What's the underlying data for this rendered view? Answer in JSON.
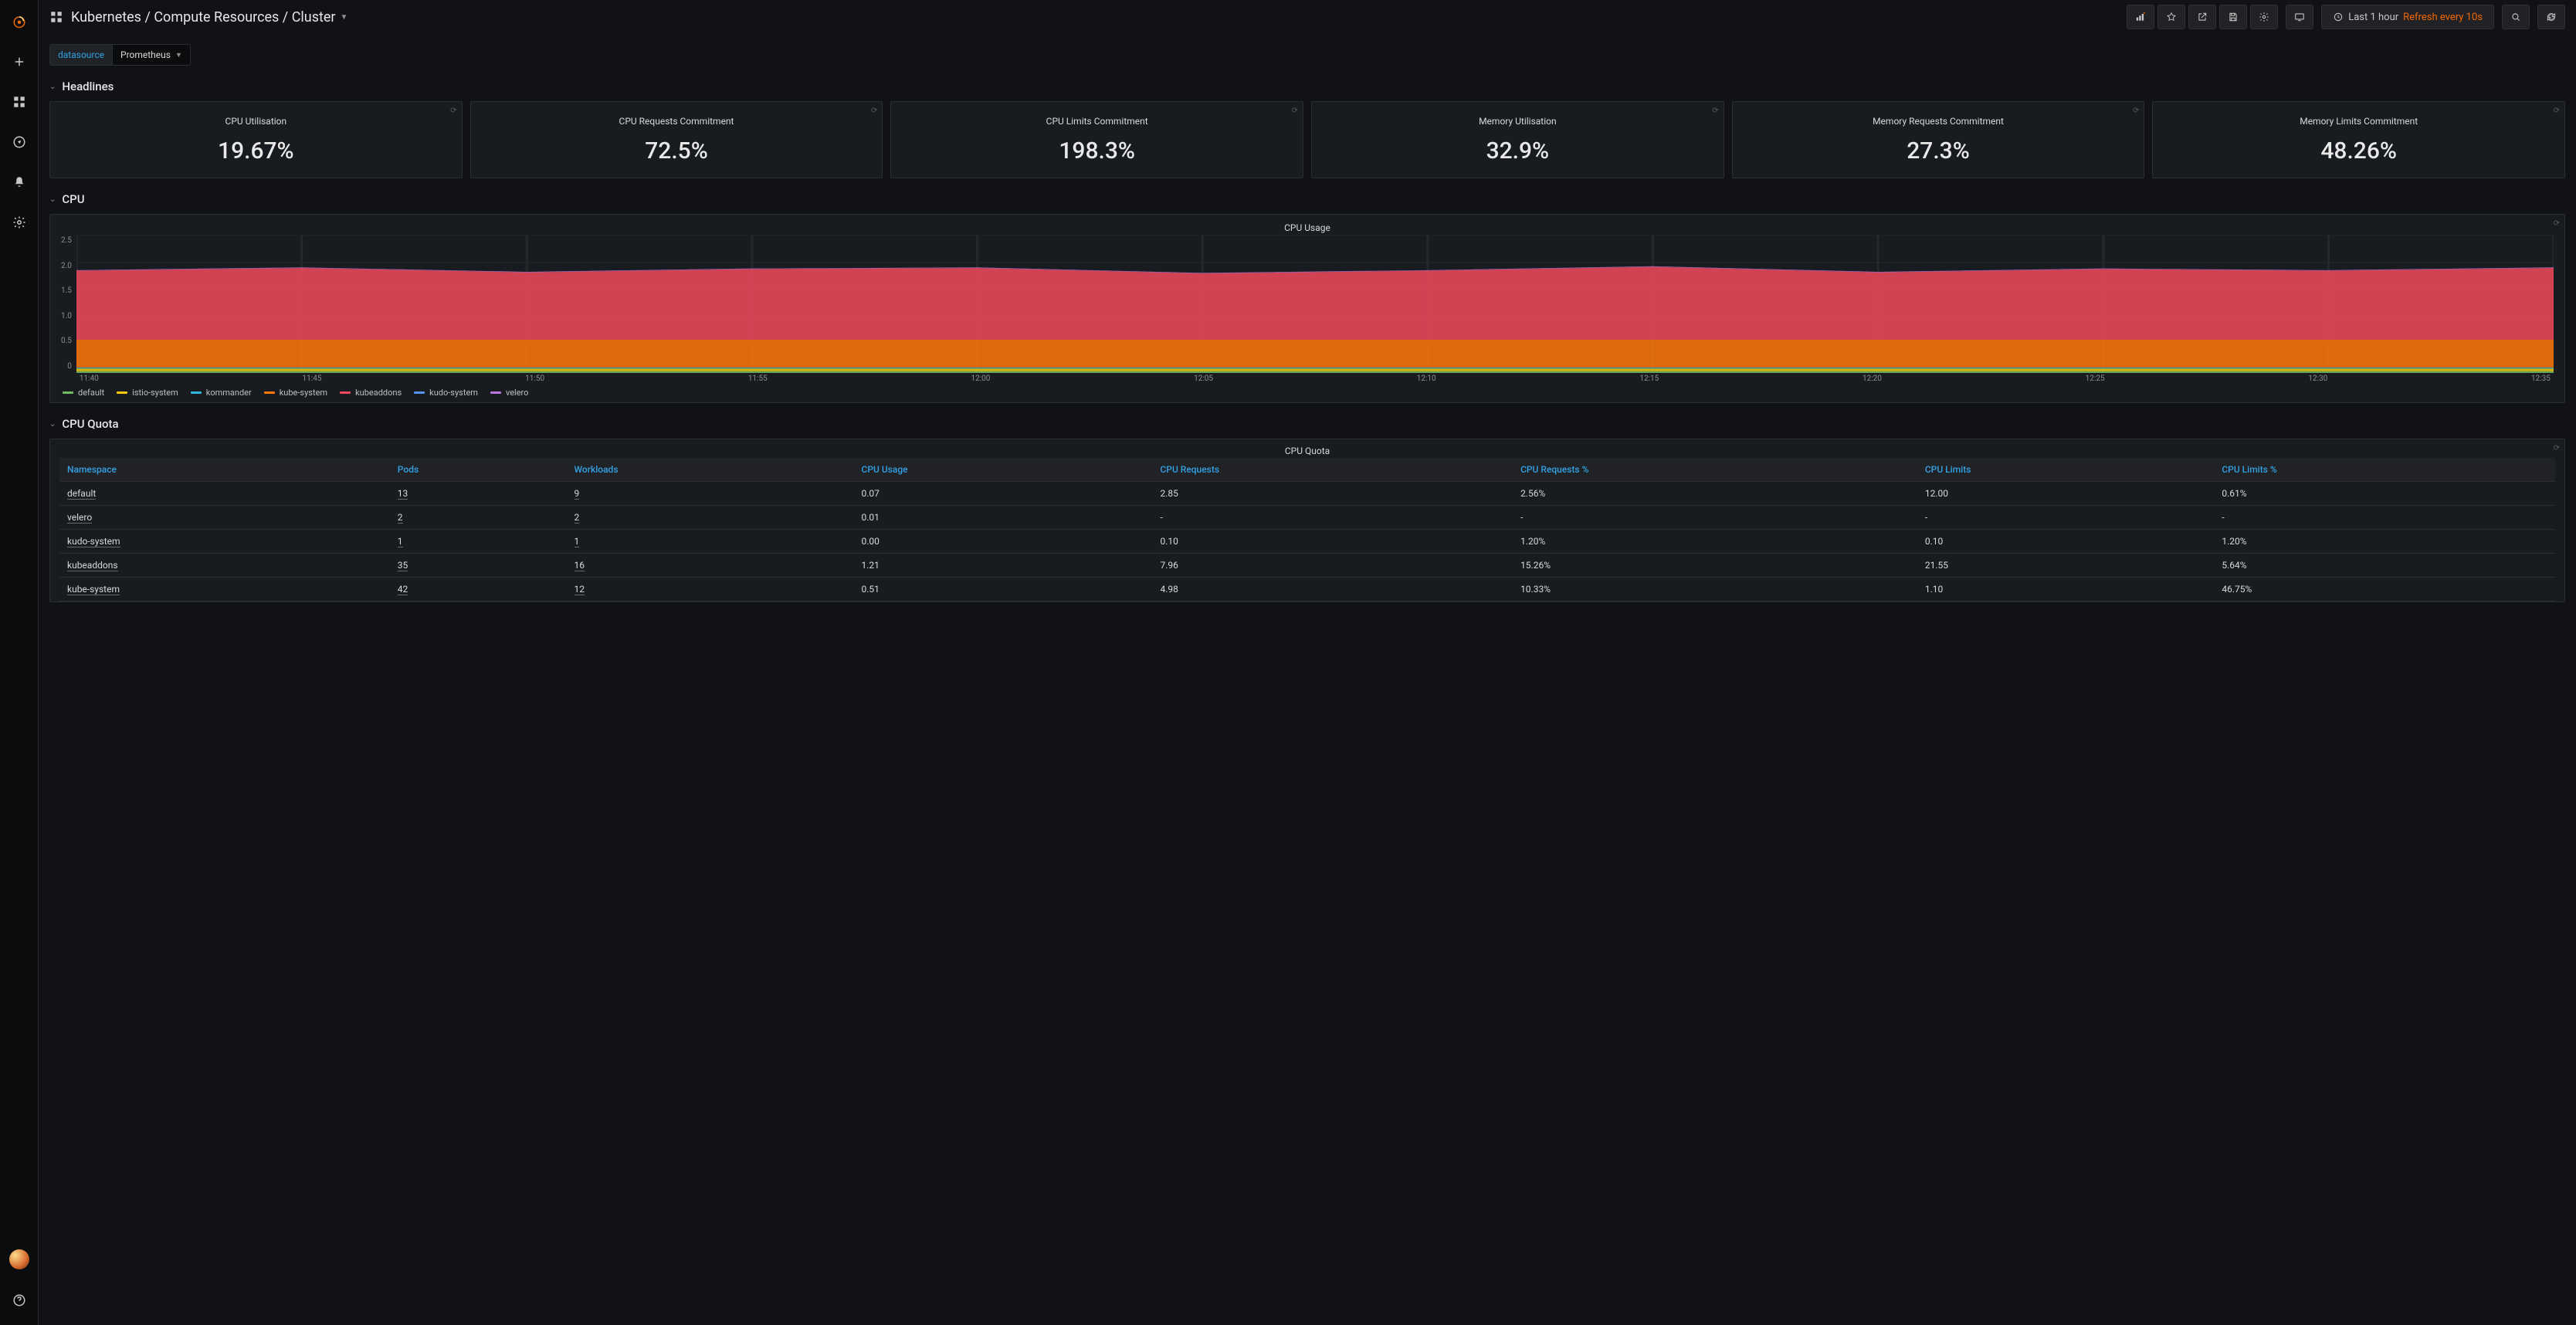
{
  "dashboard": {
    "title": "Kubernetes / Compute Resources / Cluster"
  },
  "timepicker": {
    "range_label": "Last 1 hour",
    "refresh_label": "Refresh every 10s"
  },
  "variables": {
    "datasource_label": "datasource",
    "datasource_value": "Prometheus"
  },
  "rows": {
    "headlines": "Headlines",
    "cpu": "CPU",
    "cpu_quota": "CPU Quota"
  },
  "stats": [
    {
      "title": "CPU Utilisation",
      "value": "19.67%"
    },
    {
      "title": "CPU Requests Commitment",
      "value": "72.5%"
    },
    {
      "title": "CPU Limits Commitment",
      "value": "198.3%"
    },
    {
      "title": "Memory Utilisation",
      "value": "32.9%"
    },
    {
      "title": "Memory Requests Commitment",
      "value": "27.3%"
    },
    {
      "title": "Memory Limits Commitment",
      "value": "48.26%"
    }
  ],
  "cpu_graph": {
    "title": "CPU Usage",
    "y_ticks": [
      "2.5",
      "2.0",
      "1.5",
      "1.0",
      "0.5",
      "0"
    ],
    "x_ticks": [
      "11:40",
      "11:45",
      "11:50",
      "11:55",
      "12:00",
      "12:05",
      "12:10",
      "12:15",
      "12:20",
      "12:25",
      "12:30",
      "12:35"
    ],
    "legend": [
      {
        "name": "default",
        "color": "#73bf69"
      },
      {
        "name": "istio-system",
        "color": "#f2cc0c"
      },
      {
        "name": "kommander",
        "color": "#2db6d6"
      },
      {
        "name": "kube-system",
        "color": "#ff780a"
      },
      {
        "name": "kubeaddons",
        "color": "#f2495c"
      },
      {
        "name": "kudo-system",
        "color": "#5794f2"
      },
      {
        "name": "velero",
        "color": "#b877d9"
      }
    ]
  },
  "quota": {
    "title": "CPU Quota",
    "headers": [
      "Namespace",
      "Pods",
      "Workloads",
      "CPU Usage",
      "CPU Requests",
      "CPU Requests %",
      "CPU Limits",
      "CPU Limits %"
    ],
    "rows": [
      {
        "ns": "default",
        "pods": "13",
        "wl": "9",
        "usage": "0.07",
        "req": "2.85",
        "reqp": "2.56%",
        "lim": "12.00",
        "limp": "0.61%"
      },
      {
        "ns": "velero",
        "pods": "2",
        "wl": "2",
        "usage": "0.01",
        "req": "-",
        "reqp": "-",
        "lim": "-",
        "limp": "-"
      },
      {
        "ns": "kudo-system",
        "pods": "1",
        "wl": "1",
        "usage": "0.00",
        "req": "0.10",
        "reqp": "1.20%",
        "lim": "0.10",
        "limp": "1.20%"
      },
      {
        "ns": "kubeaddons",
        "pods": "35",
        "wl": "16",
        "usage": "1.21",
        "req": "7.96",
        "reqp": "15.26%",
        "lim": "21.55",
        "limp": "5.64%"
      },
      {
        "ns": "kube-system",
        "pods": "42",
        "wl": "12",
        "usage": "0.51",
        "req": "4.98",
        "reqp": "10.33%",
        "lim": "1.10",
        "limp": "46.75%"
      }
    ]
  },
  "chart_data": {
    "type": "area",
    "title": "CPU Usage",
    "xlabel": "",
    "ylabel": "",
    "ylim": [
      0,
      2.5
    ],
    "x": [
      "11:40",
      "11:45",
      "11:50",
      "11:55",
      "12:00",
      "12:05",
      "12:10",
      "12:15",
      "12:20",
      "12:25",
      "12:30",
      "12:35"
    ],
    "series": [
      {
        "name": "default",
        "color": "#73bf69",
        "values": [
          0.03,
          0.03,
          0.03,
          0.03,
          0.03,
          0.03,
          0.03,
          0.03,
          0.03,
          0.03,
          0.03,
          0.03
        ]
      },
      {
        "name": "istio-system",
        "color": "#f2cc0c",
        "values": [
          0.05,
          0.05,
          0.05,
          0.05,
          0.05,
          0.05,
          0.05,
          0.05,
          0.05,
          0.05,
          0.05,
          0.05
        ]
      },
      {
        "name": "kommander",
        "color": "#2db6d6",
        "values": [
          0.02,
          0.02,
          0.02,
          0.02,
          0.02,
          0.02,
          0.02,
          0.02,
          0.02,
          0.02,
          0.02,
          0.02
        ]
      },
      {
        "name": "kube-system",
        "color": "#ff780a",
        "values": [
          0.5,
          0.5,
          0.5,
          0.5,
          0.5,
          0.5,
          0.5,
          0.5,
          0.5,
          0.5,
          0.5,
          0.5
        ]
      },
      {
        "name": "kubeaddons",
        "color": "#f2495c",
        "values": [
          1.25,
          1.3,
          1.22,
          1.28,
          1.3,
          1.2,
          1.25,
          1.32,
          1.22,
          1.28,
          1.25,
          1.3
        ]
      },
      {
        "name": "kudo-system",
        "color": "#5794f2",
        "values": [
          0.0,
          0.0,
          0.0,
          0.0,
          0.0,
          0.0,
          0.0,
          0.0,
          0.0,
          0.0,
          0.0,
          0.0
        ]
      },
      {
        "name": "velero",
        "color": "#b877d9",
        "values": [
          0.01,
          0.01,
          0.01,
          0.01,
          0.01,
          0.01,
          0.01,
          0.01,
          0.01,
          0.01,
          0.01,
          0.01
        ]
      }
    ]
  }
}
